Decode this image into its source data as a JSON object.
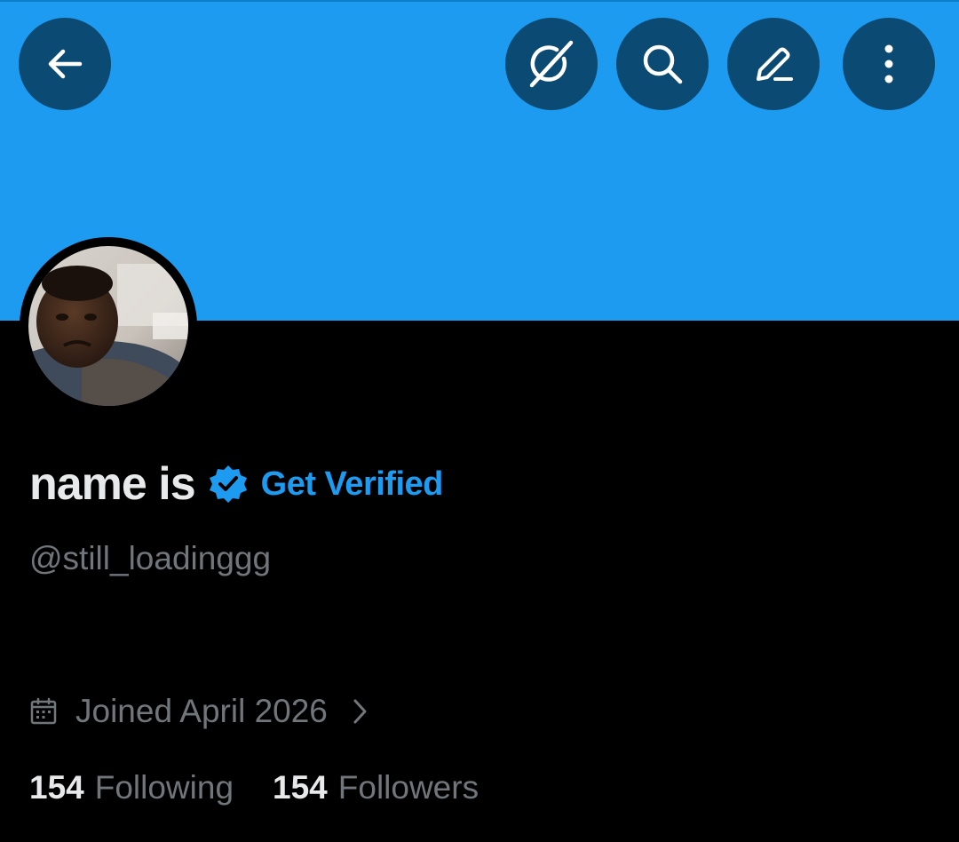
{
  "profile": {
    "display_name": "name is",
    "get_verified_label": "Get Verified",
    "handle": "@still_loadinggg",
    "joined": "Joined April 2026"
  },
  "stats": {
    "following_count": "154",
    "following_label": "Following",
    "followers_count": "154",
    "followers_label": "Followers"
  },
  "header": {
    "buttons": [
      "arrow-left-icon",
      "grok-icon",
      "search-icon",
      "pencil-icon",
      "more-vertical-icon"
    ]
  },
  "colors": {
    "banner": "#1d9bf0",
    "header_button": "#0b4a72",
    "accent": "#1d9bf0",
    "background": "#000000",
    "primary_text": "#e7e9ea",
    "secondary_text": "#71767b"
  }
}
